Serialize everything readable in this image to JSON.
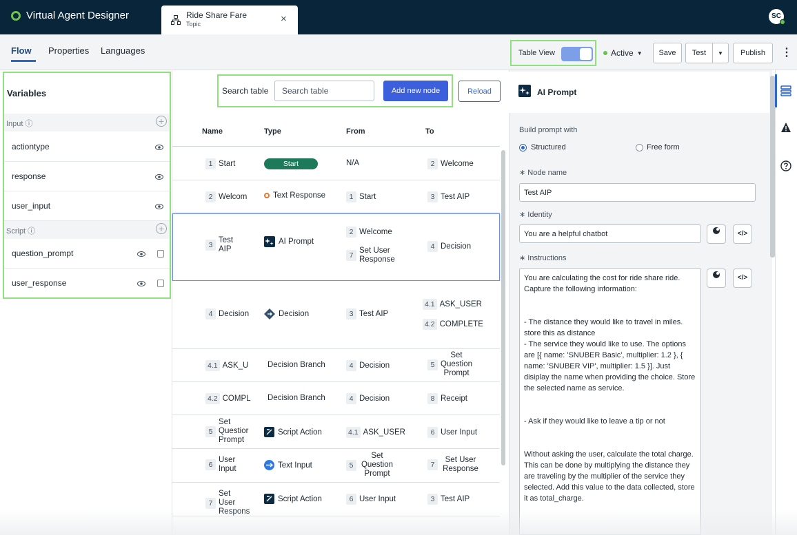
{
  "app": {
    "title": "Virtual Agent Designer",
    "tab": {
      "title": "Ride Share Fare",
      "subtitle": "Topic",
      "close": "×"
    },
    "avatar": "SC"
  },
  "subnav": {
    "tabs": [
      "Flow",
      "Properties",
      "Languages"
    ],
    "table_view_label": "Table View",
    "status": "Active",
    "buttons": {
      "save": "Save",
      "test": "Test",
      "test_menu": "▼",
      "publish": "Publish"
    }
  },
  "variables": {
    "title": "Variables",
    "input_label": "Input ⓘ",
    "input_items": [
      "actiontype",
      "response",
      "user_input"
    ],
    "script_label": "Script ⓘ",
    "script_items": [
      "question_prompt",
      "user_response"
    ]
  },
  "table": {
    "search_label": "Search table",
    "search_placeholder": "Search table",
    "add_button": "Add new node",
    "reload_button": "Reload",
    "columns": [
      "Name",
      "Type",
      "From",
      "To"
    ],
    "rows": [
      {
        "num": "1",
        "name": "Start",
        "type": "Start",
        "from": [
          {
            "num": "",
            "text": "N/A"
          }
        ],
        "to": [
          {
            "num": "2",
            "text": "Welcome"
          }
        ]
      },
      {
        "num": "2",
        "name": "Welcom",
        "type": "Text Response",
        "from": [
          {
            "num": "1",
            "text": "Start"
          }
        ],
        "to": [
          {
            "num": "3",
            "text": "Test AIP"
          }
        ]
      },
      {
        "num": "3",
        "name": "Test AIP",
        "type": "AI Prompt",
        "from": [
          {
            "num": "2",
            "text": "Welcome"
          },
          {
            "num": "7",
            "text": "Set User Response"
          }
        ],
        "to": [
          {
            "num": "4",
            "text": "Decision"
          }
        ]
      },
      {
        "num": "4",
        "name": "Decision",
        "type": "Decision",
        "from": [
          {
            "num": "3",
            "text": "Test AIP"
          }
        ],
        "to": [
          {
            "num": "4.1",
            "text": "ASK_USER"
          },
          {
            "num": "4.2",
            "text": "COMPLETE"
          }
        ]
      },
      {
        "num": "4.1",
        "name": "ASK_U",
        "type": "Decision Branch",
        "from": [
          {
            "num": "4",
            "text": "Decision"
          }
        ],
        "to": [
          {
            "num": "5",
            "text": "Set Question Prompt"
          }
        ]
      },
      {
        "num": "4.2",
        "name": "COMPL",
        "type": "Decision Branch",
        "from": [
          {
            "num": "4",
            "text": "Decision"
          }
        ],
        "to": [
          {
            "num": "8",
            "text": "Receipt"
          }
        ]
      },
      {
        "num": "5",
        "name": "Set Questior Prompt",
        "type": "Script Action",
        "from": [
          {
            "num": "4.1",
            "text": "ASK_USER"
          }
        ],
        "to": [
          {
            "num": "6",
            "text": "User Input"
          }
        ]
      },
      {
        "num": "6",
        "name": "User Input",
        "type": "Text Input",
        "from": [
          {
            "num": "5",
            "text": "Set Question Prompt"
          }
        ],
        "to": [
          {
            "num": "7",
            "text": "Set User Response"
          }
        ]
      },
      {
        "num": "7",
        "name": "Set User Respons",
        "type": "Script Action",
        "from": [
          {
            "num": "6",
            "text": "User Input"
          }
        ],
        "to": [
          {
            "num": "3",
            "text": "Test AIP"
          }
        ]
      }
    ]
  },
  "ai_prompt": {
    "title": "AI Prompt",
    "build_label": "Build prompt with",
    "structured_label": "Structured",
    "freeform_label": "Free form",
    "node_name_label": "∗ Node name",
    "node_name_value": "Test AIP",
    "identity_label": "∗ Identity",
    "identity_value": "You are a helpful chatbot",
    "instructions_label": "∗ Instructions",
    "instructions_value": "You are calculating the cost for ride share ride. Capture the following information:\n\n\n- The distance they would like to travel in miles. store this as distance\n- The service they would like to use. The options are [{ name: 'SNUBER Basic', multiplier: 1.2 }, { name: 'SNUBER VIP', multiplier: 1.5 }]. Just disiplay the name when providing the choice. Store the selected name as service.\n\n\n- Ask if they would like to leave a tip or not\n\n\nWithout asking the user, calculate the total charge. This can be done by multiplying the distance they are traveling by the multiplier of the service they selected. Add this value to the data collected, store it as total_charge.",
    "code_icon": "</>"
  },
  "colors": {
    "topbar": "#08253a",
    "accent": "#3c5fdc",
    "highlight": "#90e07f",
    "start_pill": "#1c7a5a"
  }
}
